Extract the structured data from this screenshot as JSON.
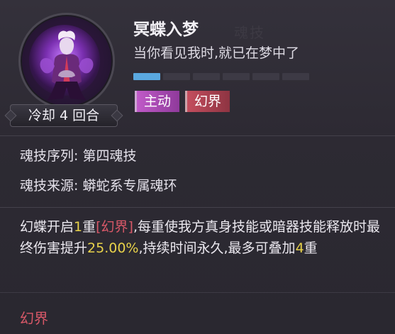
{
  "skill": {
    "name": "冥蝶入梦",
    "description": "当你看见我时,就已在梦中了",
    "cooldown": "冷却 4 回合",
    "level": {
      "current": 1,
      "max": 6
    },
    "tags": [
      "主动",
      "幻界"
    ]
  },
  "info": {
    "sequence_label": "魂技序列:",
    "sequence_value": "第四魂技",
    "source_label": "魂技来源:",
    "source_value": "蟒蛇系专属魂环"
  },
  "effect": {
    "p1": "幻蝶开启",
    "n1": "1",
    "p2": "重",
    "realm": "[幻界]",
    "p3": ",每重使我方真身技能或暗器技能释放时最终伤害提升",
    "n2": "25.00%",
    "p4": ",持续时间永久,最多可叠加",
    "n3": "4",
    "p5": "重"
  },
  "section": {
    "title": "幻界"
  },
  "colors": {
    "highlight": "#e8d24a",
    "realm": "#d85868",
    "level_fill": "#5aa8e0"
  }
}
